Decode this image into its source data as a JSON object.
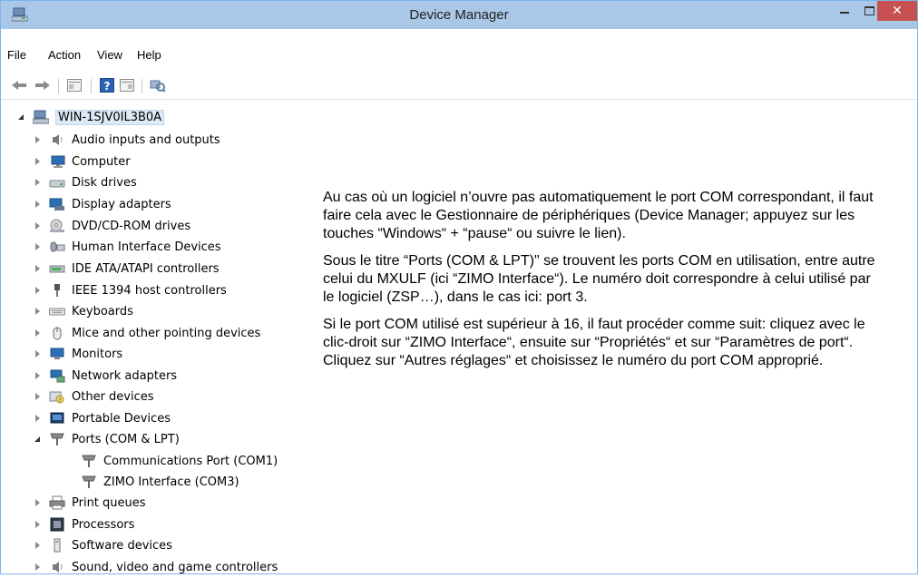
{
  "window": {
    "title": "Device Manager",
    "controls": {
      "minimize": "–",
      "maximize": "□",
      "close": "✕"
    },
    "colors": {
      "titlebar": "#a9c7e6",
      "close": "#c75050",
      "selection": "#dde9f6"
    }
  },
  "menu": [
    "File",
    "Action",
    "View",
    "Help"
  ],
  "toolbar": [
    "back-arrow-icon",
    "forward-arrow-icon",
    "properties-icon",
    "help-icon",
    "view-icon",
    "scan-hardware-icon"
  ],
  "tree": {
    "root": "WIN-1SJV0IL3B0A",
    "items": [
      {
        "label": "Audio inputs and outputs",
        "icon": "speaker-icon",
        "expanded": false
      },
      {
        "label": "Computer",
        "icon": "computer-icon",
        "expanded": false
      },
      {
        "label": "Disk drives",
        "icon": "disk-drive-icon",
        "expanded": false
      },
      {
        "label": "Display adapters",
        "icon": "display-adapter-icon",
        "expanded": false
      },
      {
        "label": "DVD/CD-ROM drives",
        "icon": "dvd-drive-icon",
        "expanded": false
      },
      {
        "label": "Human Interface Devices",
        "icon": "hid-icon",
        "expanded": false
      },
      {
        "label": "IDE ATA/ATAPI controllers",
        "icon": "ide-controller-icon",
        "expanded": false
      },
      {
        "label": "IEEE 1394 host controllers",
        "icon": "ieee1394-icon",
        "expanded": false
      },
      {
        "label": "Keyboards",
        "icon": "keyboard-icon",
        "expanded": false
      },
      {
        "label": "Mice and other pointing devices",
        "icon": "mouse-icon",
        "expanded": false
      },
      {
        "label": "Monitors",
        "icon": "monitor-icon",
        "expanded": false
      },
      {
        "label": "Network adapters",
        "icon": "network-adapter-icon",
        "expanded": false
      },
      {
        "label": "Other devices",
        "icon": "unknown-device-icon",
        "expanded": false
      },
      {
        "label": "Portable Devices",
        "icon": "portable-device-icon",
        "expanded": false
      },
      {
        "label": "Ports (COM & LPT)",
        "icon": "port-icon",
        "expanded": true,
        "children": [
          {
            "label": "Communications Port (COM1)",
            "icon": "port-icon"
          },
          {
            "label": "ZIMO Interface (COM3)",
            "icon": "port-icon"
          }
        ]
      },
      {
        "label": "Print queues",
        "icon": "printer-icon",
        "expanded": false
      },
      {
        "label": "Processors",
        "icon": "processor-icon",
        "expanded": false
      },
      {
        "label": "Software devices",
        "icon": "software-device-icon",
        "expanded": false
      },
      {
        "label": "Sound, video and game controllers",
        "icon": "speaker-icon",
        "expanded": false
      }
    ]
  },
  "explanation": [
    "Au cas où un logiciel n’ouvre pas automatiquement le port COM correspondant, il faut faire cela avec le Gestionnaire de périphériques (Device Manager; appuyez sur les touches “Windows“ + “pause“ ou suivre le lien).",
    "Sous le titre “Ports (COM & LPT)\" se trouvent les ports COM en utilisation, entre autre celui du MXULF (ici “ZIMO Interface“). Le numéro doit correspondre à celui utilisé par le logiciel (ZSP…), dans le cas ici: port 3.",
    "Si le port COM utilisé est supérieur à 16, il faut procéder comme suit: cliquez avec le clic-droit sur “ZIMO Interface“, ensuite sur “Propriétés“ et sur “Paramètres de port“. Cliquez sur “Autres réglages“ et choisissez le numéro du port COM approprié."
  ]
}
